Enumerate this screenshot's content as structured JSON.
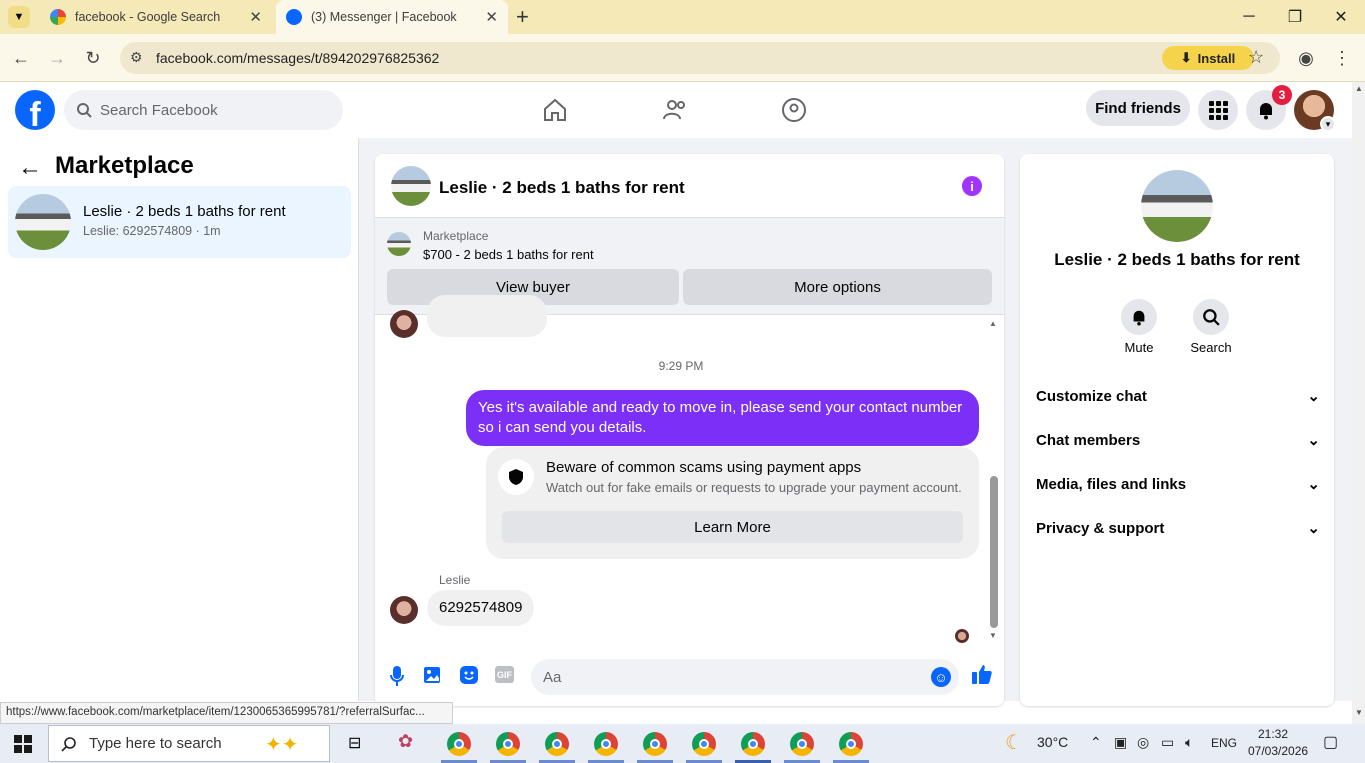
{
  "browser": {
    "tabs": [
      {
        "title": "facebook - Google Search",
        "active": false
      },
      {
        "title": "(3) Messenger | Facebook",
        "active": true
      }
    ],
    "url": "facebook.com/messages/t/894202976825362",
    "install_label": "Install",
    "status_url": "https://www.facebook.com/marketplace/item/1230065365995781/?referralSurfac..."
  },
  "fb": {
    "search_placeholder": "Search Facebook",
    "find_friends": "Find friends",
    "notif_count": "3"
  },
  "left": {
    "heading": "Marketplace",
    "conversation": {
      "title": "Leslie · 2 beds 1 baths for rent",
      "preview": "Leslie: 6292574809 · 1m"
    }
  },
  "chat": {
    "title": "Leslie · 2 beds 1 baths for rent",
    "marketplace_label": "Marketplace",
    "listing": "$700 - 2 beds 1 baths for rent",
    "view_buyer": "View buyer",
    "more_options": "More options",
    "timestamp": "9:29 PM",
    "outgoing": "Yes it's available and ready to move in, please send your contact number so i can send you details.",
    "scam_title": "Beware of common scams using payment apps",
    "scam_body": "Watch out for fake emails or requests to upgrade your payment account.",
    "learn_more": "Learn More",
    "sender": "Leslie",
    "incoming": "6292574809",
    "input_placeholder": "Aa"
  },
  "right": {
    "title": "Leslie · 2 beds 1 baths for rent",
    "mute": "Mute",
    "search": "Search",
    "sections": [
      "Customize chat",
      "Chat members",
      "Media, files and links",
      "Privacy & support"
    ]
  },
  "taskbar": {
    "search_placeholder": "Type here to search",
    "weather": "30°C",
    "lang": "ENG",
    "time": "21:32",
    "date": "07/03/2026"
  },
  "colors": {
    "fb_blue": "#0866ff",
    "messenger_purple": "#7b2ff7",
    "badge_red": "#e41e3f"
  }
}
